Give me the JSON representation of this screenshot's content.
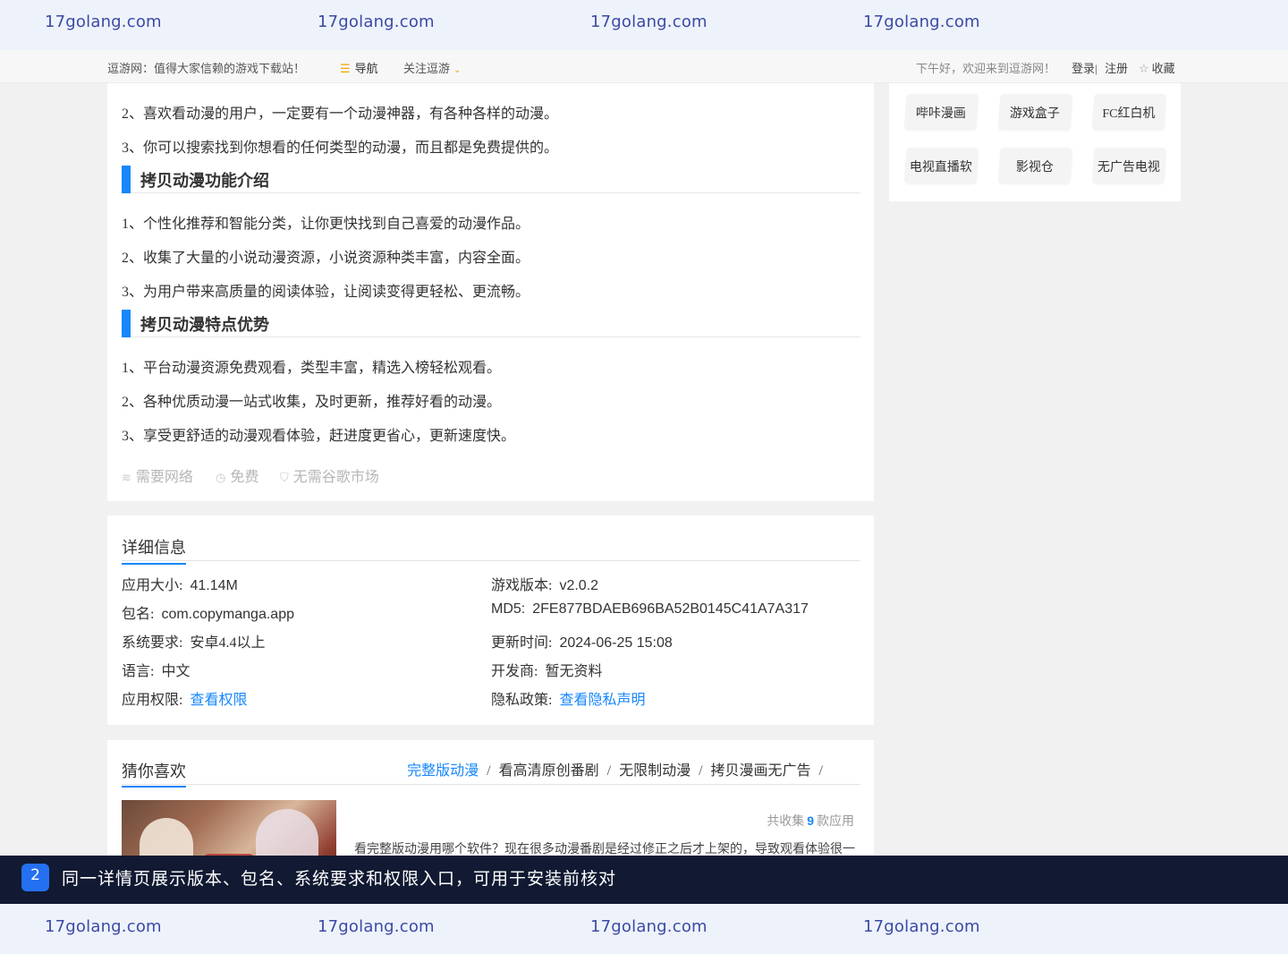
{
  "watermark": {
    "text": "17golang.com"
  },
  "topnav": {
    "slogan": "逗游网：值得大家信赖的游戏下载站！",
    "nav_icon": "menu-icon",
    "nav_label": "导航",
    "follow_label": "关注逗游",
    "greeting": "下午好，欢迎来到逗游网！",
    "login": "登录|",
    "register": "注册",
    "favorite": "收藏"
  },
  "intro": {
    "lines_top": [
      "2、喜欢看动漫的用户，一定要有一个动漫神器，有各种各样的动漫。",
      "3、你可以搜索找到你想看的任何类型的动漫，而且都是免费提供的。"
    ],
    "section1_title": "拷贝动漫功能介绍",
    "section1_lines": [
      "1、个性化推荐和智能分类，让你更快找到自己喜爱的动漫作品。",
      "2、收集了大量的小说动漫资源，小说资源种类丰富，内容全面。",
      "3、为用户带来高质量的阅读体验，让阅读变得更轻松、更流畅。"
    ],
    "section2_title": "拷贝动漫特点优势",
    "section2_lines": [
      "1、平台动漫资源免费观看，类型丰富，精选入榜轻松观看。",
      "2、各种优质动漫一站式收集，及时更新，推荐好看的动漫。",
      "3、享受更舒适的动漫观看体验，赶进度更省心，更新速度快。"
    ],
    "features": [
      {
        "icon": "wifi-icon",
        "label": "需要网络"
      },
      {
        "icon": "clock-icon",
        "label": "免费"
      },
      {
        "icon": "shield-icon",
        "label": "无需谷歌市场"
      }
    ]
  },
  "detail": {
    "title": "详细信息",
    "size_label": "应用大小:",
    "size_value": "41.14M",
    "version_label": "游戏版本:",
    "version_value": "v2.0.2",
    "package_label": "包名:",
    "package_value": "com.copymanga.app",
    "md5_label": "MD5:",
    "md5_value": "2FE877BDAEB696BA52B0145C41A7A317",
    "system_label": "系统要求:",
    "system_value": "安卓4.4以上",
    "updated_label": "更新时间:",
    "updated_value": "2024-06-25 15:08",
    "language_label": "语言:",
    "language_value": "中文",
    "developer_label": "开发商:",
    "developer_value": "暂无资料",
    "permission_label": "应用权限:",
    "permission_link": "查看权限",
    "privacy_label": "隐私政策:",
    "privacy_link": "查看隐私声明"
  },
  "guess": {
    "title": "猜你喜欢",
    "tabs": [
      "完整版动漫",
      "看高清原创番剧",
      "无限制动漫",
      "拷贝漫画无广告"
    ],
    "count_prefix": "共收集",
    "count_value": "9",
    "count_suffix": "款应用",
    "description": "看完整版动漫用哪个软件？现在很多动漫番剧是经过修正之后才上架的，导致观看体验很一"
  },
  "tags": [
    "哔咔漫画",
    "游戏盒子",
    "FC红白机",
    "电视直播软",
    "影视仓",
    "无广告电视"
  ],
  "banner": {
    "number": "2",
    "text": "同一详情页展示版本、包名、系统要求和权限入口，可用于安装前核对"
  },
  "colors": {
    "accent": "#1787fb",
    "banner_bg": "#111a32",
    "watermark": "#3b4aa5"
  }
}
